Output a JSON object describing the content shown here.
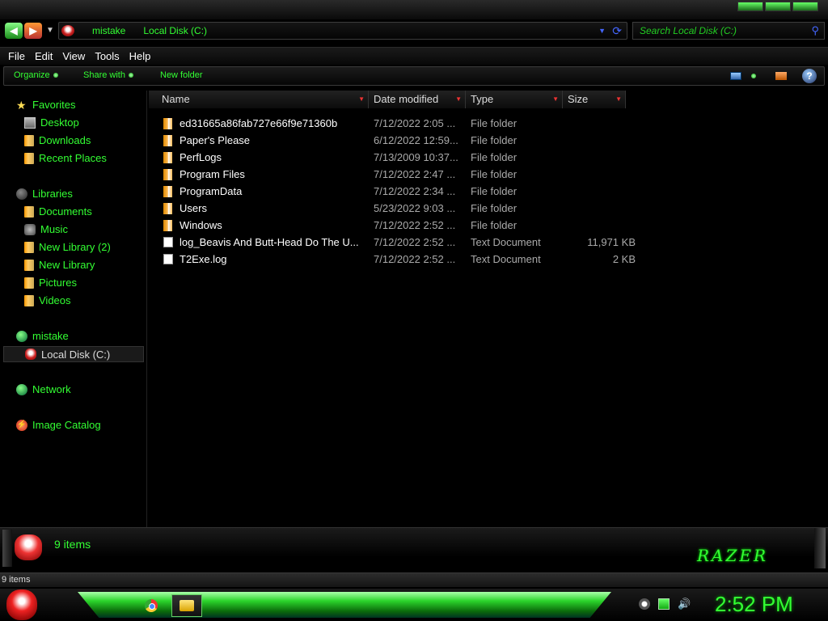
{
  "address": {
    "crumbs": [
      "mistake",
      "Local Disk (C:)"
    ]
  },
  "search": {
    "placeholder": "Search Local Disk (C:)"
  },
  "menu": [
    "File",
    "Edit",
    "View",
    "Tools",
    "Help"
  ],
  "toolbar": {
    "organize": "Organize",
    "share_with": "Share with",
    "new_folder": "New folder"
  },
  "nav": {
    "favorites": "Favorites",
    "desktop": "Desktop",
    "downloads": "Downloads",
    "recent_places": "Recent Places",
    "libraries": "Libraries",
    "documents": "Documents",
    "music": "Music",
    "new_library_2": "New Library (2)",
    "new_library": "New Library",
    "pictures": "Pictures",
    "videos": "Videos",
    "computer": "mistake",
    "local_disk": "Local Disk (C:)",
    "network": "Network",
    "image_catalog": "Image Catalog"
  },
  "columns": {
    "name": "Name",
    "date_modified": "Date modified",
    "type": "Type",
    "size": "Size"
  },
  "files": [
    {
      "name": "ed31665a86fab727e66f9e71360b",
      "date": "7/12/2022 2:05 ...",
      "type": "File folder",
      "size": "",
      "kind": "folder"
    },
    {
      "name": "Paper's Please",
      "date": "6/12/2022 12:59...",
      "type": "File folder",
      "size": "",
      "kind": "folder"
    },
    {
      "name": "PerfLogs",
      "date": "7/13/2009 10:37...",
      "type": "File folder",
      "size": "",
      "kind": "folder"
    },
    {
      "name": "Program Files",
      "date": "7/12/2022 2:47 ...",
      "type": "File folder",
      "size": "",
      "kind": "folder"
    },
    {
      "name": "ProgramData",
      "date": "7/12/2022 2:34 ...",
      "type": "File folder",
      "size": "",
      "kind": "folder"
    },
    {
      "name": "Users",
      "date": "5/23/2022 9:03 ...",
      "type": "File folder",
      "size": "",
      "kind": "folder"
    },
    {
      "name": "Windows",
      "date": "7/12/2022 2:52 ...",
      "type": "File folder",
      "size": "",
      "kind": "folder"
    },
    {
      "name": "log_Beavis And Butt-Head Do The U...",
      "date": "7/12/2022 2:52 ...",
      "type": "Text Document",
      "size": "11,971 KB",
      "kind": "doc"
    },
    {
      "name": "T2Exe.log",
      "date": "7/12/2022 2:52 ...",
      "type": "Text Document",
      "size": "2 KB",
      "kind": "doc"
    }
  ],
  "details": {
    "item_count": "9 items",
    "logo_text": "RAZER"
  },
  "status": {
    "text": "9 items"
  },
  "taskbar": {
    "clock": "2:52 PM"
  },
  "icons": {
    "back": "back-arrow-icon",
    "forward": "forward-arrow-icon",
    "search": "search-icon",
    "help": "help-icon"
  },
  "colors": {
    "accent": "#33ff33",
    "sort_arrow": "#ee3333",
    "background": "#000000"
  }
}
